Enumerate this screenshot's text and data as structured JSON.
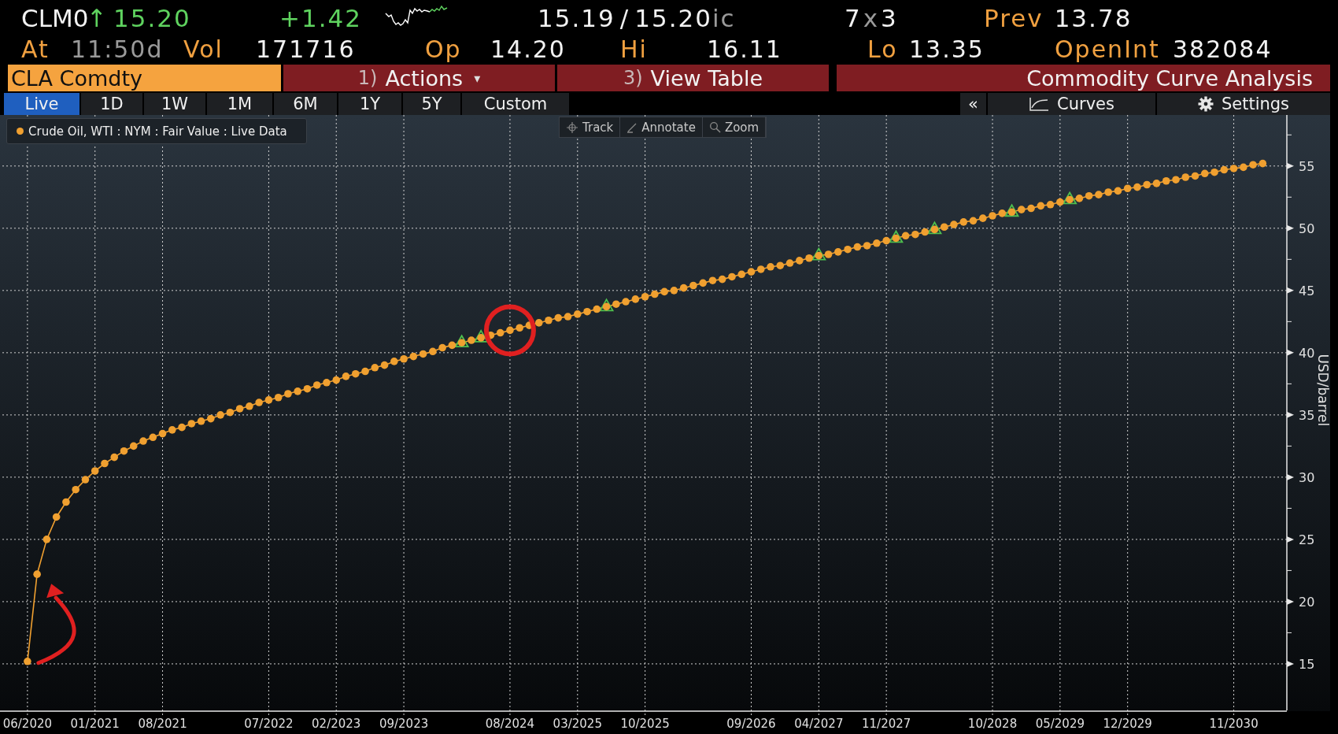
{
  "quote": {
    "ticker": "CLM0",
    "direction": "↑",
    "last": "15.20",
    "change": "+1.42",
    "bid": "15.19",
    "bid_ask_separator": "/",
    "ask": "15.20",
    "ask_source": "ic",
    "size_bid": "7",
    "size_separator": "x",
    "size_ask": "3",
    "prev_label": "Prev",
    "prev": "13.78"
  },
  "stats": [
    {
      "label": "At",
      "value": "11:50d",
      "stale": true
    },
    {
      "label": "Vol",
      "value": "171716",
      "stale": false
    },
    {
      "label": "Op",
      "value": "14.20",
      "stale": false
    },
    {
      "label": "Hi",
      "value": "16.11",
      "stale": false
    },
    {
      "label": "Lo",
      "value": "13.35",
      "stale": false
    },
    {
      "label": "OpenInt",
      "value": "382084",
      "stale": false
    }
  ],
  "security": "CLA Comdty",
  "menu_buttons": [
    {
      "number": "1)",
      "label": "Actions",
      "caret": "▾"
    },
    {
      "number": "3)",
      "label": "View Table"
    }
  ],
  "function_title": "Commodity Curve Analysis",
  "range_tabs": [
    {
      "label": "Live",
      "selected": true
    },
    {
      "label": "1D",
      "selected": false
    },
    {
      "label": "1W",
      "selected": false
    },
    {
      "label": "1M",
      "selected": false
    },
    {
      "label": "6M",
      "selected": false
    },
    {
      "label": "1Y",
      "selected": false
    },
    {
      "label": "5Y",
      "selected": false
    },
    {
      "label": "Custom",
      "selected": false
    }
  ],
  "panel_toggle": "«",
  "view_buttons": [
    {
      "label": "Curves",
      "kind": "curves"
    },
    {
      "label": "Settings",
      "kind": "gear"
    }
  ],
  "chart_tools": [
    {
      "label": "Track",
      "kind": "track"
    },
    {
      "label": "Annotate",
      "kind": "annotate"
    },
    {
      "label": "Zoom",
      "kind": "zoom"
    }
  ],
  "chart": {
    "chart_data": {
      "type": "line",
      "ylabel": "USD/barrel",
      "categories": [
        "06/2020",
        null,
        null,
        null,
        null,
        null,
        null,
        "01/2021",
        null,
        null,
        null,
        null,
        null,
        null,
        "08/2021",
        null,
        null,
        null,
        null,
        null,
        null,
        null,
        null,
        null,
        null,
        "07/2022",
        null,
        null,
        null,
        null,
        null,
        null,
        "02/2023",
        null,
        null,
        null,
        null,
        null,
        null,
        "09/2023",
        null,
        null,
        null,
        null,
        null,
        null,
        null,
        null,
        null,
        null,
        "08/2024",
        null,
        null,
        null,
        null,
        null,
        null,
        "03/2025",
        null,
        null,
        null,
        null,
        null,
        null,
        "10/2025",
        null,
        null,
        null,
        null,
        null,
        null,
        null,
        null,
        null,
        null,
        "09/2026",
        null,
        null,
        null,
        null,
        null,
        null,
        "04/2027",
        null,
        null,
        null,
        null,
        null,
        null,
        "11/2027",
        null,
        null,
        null,
        null,
        null,
        null,
        null,
        null,
        null,
        null,
        "10/2028",
        null,
        null,
        null,
        null,
        null,
        null,
        "05/2029",
        null,
        null,
        null,
        null,
        null,
        null,
        "12/2029",
        null,
        null,
        null,
        null,
        null,
        null,
        null,
        null,
        null,
        null,
        "11/2030",
        null,
        null,
        null
      ],
      "grid": true,
      "series": [
        {
          "name": "Crude Oil, WTI : NYM : Fair Value : Live Data",
          "color": "#f0a030",
          "marker": "circle",
          "values": [
            15.2,
            22.2,
            25.0,
            26.8,
            28.0,
            29.0,
            29.8,
            30.5,
            31.1,
            31.6,
            32.1,
            32.5,
            32.9,
            33.2,
            33.5,
            33.8,
            34.0,
            34.3,
            34.5,
            34.7,
            35.0,
            35.2,
            35.5,
            35.7,
            36.0,
            36.2,
            36.4,
            36.7,
            36.9,
            37.1,
            37.4,
            37.6,
            37.8,
            38.1,
            38.3,
            38.5,
            38.8,
            39.0,
            39.3,
            39.5,
            39.7,
            39.9,
            40.1,
            40.4,
            40.6,
            40.8,
            41.0,
            41.2,
            41.4,
            41.6,
            41.8,
            42.0,
            42.2,
            42.4,
            42.6,
            42.8,
            42.9,
            43.1,
            43.3,
            43.5,
            43.7,
            43.9,
            44.1,
            44.3,
            44.5,
            44.7,
            44.9,
            45.0,
            45.2,
            45.4,
            45.6,
            45.8,
            45.9,
            46.1,
            46.3,
            46.5,
            46.7,
            46.9,
            47.0,
            47.2,
            47.4,
            47.6,
            47.8,
            47.9,
            48.1,
            48.3,
            48.5,
            48.6,
            48.8,
            49.0,
            49.2,
            49.4,
            49.5,
            49.7,
            49.9,
            50.1,
            50.3,
            50.5,
            50.6,
            50.8,
            51.0,
            51.2,
            51.3,
            51.5,
            51.6,
            51.8,
            51.9,
            52.1,
            52.3,
            52.4,
            52.6,
            52.7,
            52.9,
            53.0,
            53.2,
            53.3,
            53.5,
            53.6,
            53.8,
            53.9,
            54.1,
            54.2,
            54.4,
            54.5,
            54.7,
            54.8,
            54.9,
            55.1,
            55.2
          ]
        },
        {
          "color": "#4ec04e",
          "type": "scatter",
          "marker": "triangle",
          "values": [
            null,
            null,
            null,
            null,
            null,
            null,
            null,
            null,
            null,
            null,
            null,
            null,
            null,
            null,
            null,
            null,
            null,
            null,
            null,
            null,
            null,
            null,
            null,
            null,
            null,
            null,
            null,
            null,
            null,
            null,
            null,
            null,
            null,
            null,
            null,
            null,
            null,
            null,
            null,
            null,
            null,
            null,
            null,
            null,
            null,
            40.8,
            null,
            41.2,
            null,
            null,
            null,
            null,
            null,
            null,
            null,
            null,
            null,
            null,
            null,
            null,
            43.7,
            null,
            null,
            null,
            null,
            null,
            null,
            null,
            null,
            null,
            null,
            null,
            null,
            null,
            null,
            null,
            null,
            null,
            null,
            null,
            null,
            null,
            47.8,
            null,
            null,
            null,
            null,
            null,
            null,
            null,
            49.2,
            null,
            null,
            null,
            49.9,
            null,
            null,
            null,
            null,
            null,
            null,
            null,
            51.3,
            null,
            null,
            null,
            null,
            null,
            52.3,
            null,
            null,
            null,
            null,
            null,
            null,
            null,
            null,
            null,
            null,
            null,
            null,
            null,
            null,
            null,
            null,
            null,
            null,
            null,
            null
          ]
        }
      ],
      "ylim": [
        11.2,
        59.1
      ],
      "yticks": [
        15,
        20,
        25,
        30,
        35,
        40,
        45,
        50,
        55
      ]
    },
    "highlights": [
      {
        "kind": "circle",
        "color": "#e02020"
      },
      {
        "kind": "arrow",
        "color": "#e02020"
      }
    ]
  }
}
